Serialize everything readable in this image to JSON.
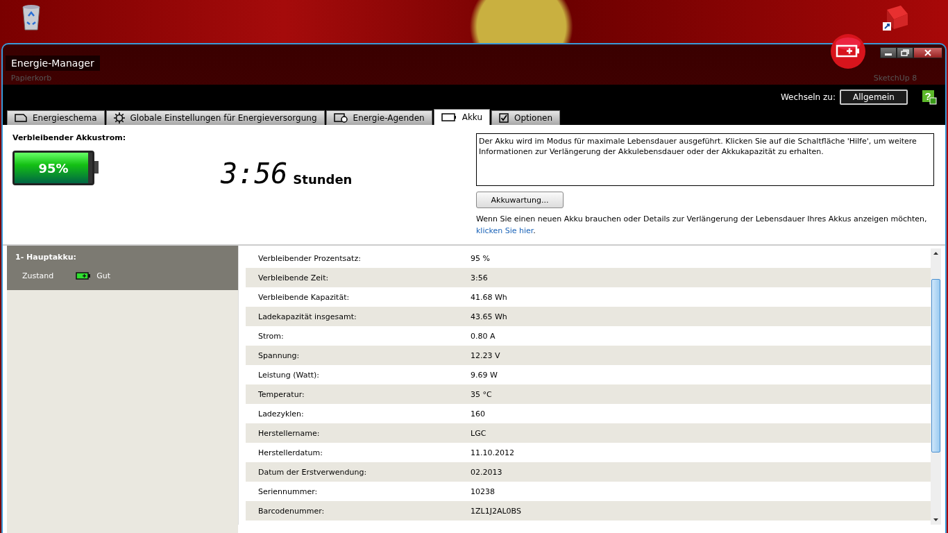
{
  "desktop": {
    "icons": [
      {
        "label": "Papierkorb",
        "kind": "bin"
      },
      {
        "label": "SketchUp 8",
        "kind": "app"
      }
    ]
  },
  "window": {
    "title": "Energie-Manager"
  },
  "toolbar": {
    "switch_label": "Wechseln zu:",
    "switch_button": "Allgemein",
    "help_symbol": "?"
  },
  "tabs": [
    {
      "label": "Energieschema",
      "kind": "scheme",
      "selected": false
    },
    {
      "label": "Globale Einstellungen für Energieversorgung",
      "kind": "settings",
      "selected": false
    },
    {
      "label": "Energie-Agenden",
      "kind": "agenda",
      "selected": false
    },
    {
      "label": "Akku",
      "kind": "battery",
      "selected": true
    },
    {
      "label": "Optionen",
      "kind": "options",
      "selected": false
    }
  ],
  "summary": {
    "label": "Verbleibender Akkustrom:",
    "level": 0.95,
    "percent": "95%",
    "time": "3:56",
    "unit": "Stunden"
  },
  "info": {
    "text": "Der Akku wird im Modus für maximale Lebensdauer ausgeführt. Klicken Sie auf die Schaltfläche 'Hilfe', um weitere Informationen zur Verlängerung der Akkulebensdauer oder der Akkukapazität zu erhalten.",
    "button": "Akkuwartung...",
    "note": "Wenn Sie einen neuen Akku brauchen oder Details zur Verlängerung der Lebensdauer Ihres Akkus anzeigen möchten,",
    "link": "klicken Sie hier",
    "after_link": "."
  },
  "battery_list": {
    "title": "1- Hauptakku:",
    "status_label": "Zustand",
    "status": "Gut"
  },
  "details": [
    {
      "label": "Verbleibender Prozentsatz:",
      "value": "95 %"
    },
    {
      "label": "Verbleibende Zeit:",
      "value": "3:56"
    },
    {
      "label": "Verbleibende Kapazität:",
      "value": "41.68 Wh"
    },
    {
      "label": "Ladekapazität insgesamt:",
      "value": "43.65 Wh"
    },
    {
      "label": "Strom:",
      "value": "0.80 A"
    },
    {
      "label": "Spannung:",
      "value": "12.23 V"
    },
    {
      "label": "Leistung (Watt):",
      "value": "9.69 W"
    },
    {
      "label": "Temperatur:",
      "value": "35 °C"
    },
    {
      "label": "Ladezyklen:",
      "value": "160"
    },
    {
      "label": "Herstellername:",
      "value": "LGC"
    },
    {
      "label": "Herstellerdatum:",
      "value": "11.10.2012"
    },
    {
      "label": "Datum der Erstverwendung:",
      "value": "02.2013"
    },
    {
      "label": "Seriennummer:",
      "value": "10238"
    },
    {
      "label": "Barcodenummer:",
      "value": "1ZL1J2AL0BS"
    }
  ]
}
